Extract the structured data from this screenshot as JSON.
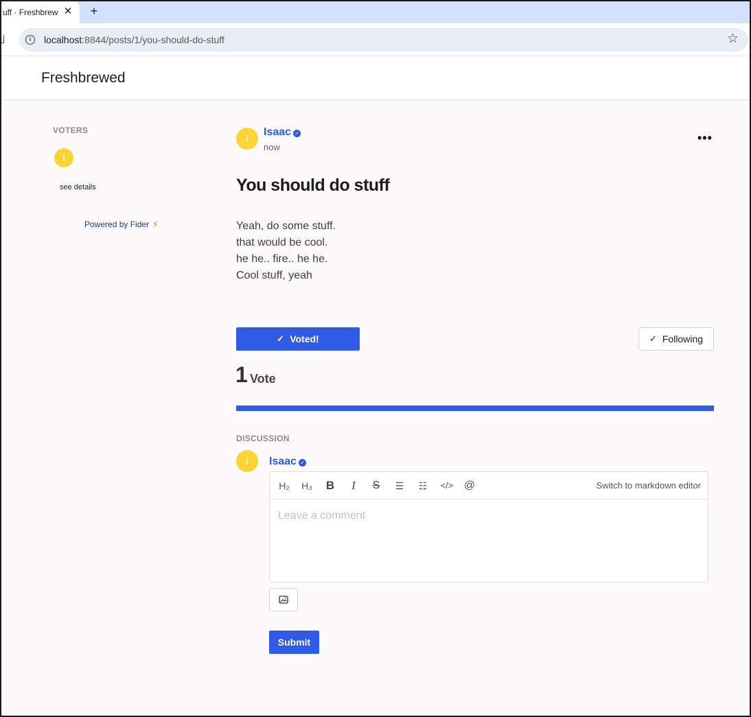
{
  "browser": {
    "tab_title": "uff · Freshbrew",
    "close_glyph": "✕",
    "new_tab_glyph": "+",
    "url_host": "localhost",
    "url_rest": ":8844/posts/1/you-should-do-stuff",
    "star_glyph": "☆",
    "icons": [
      "info-icon",
      "star-icon",
      "close-icon",
      "plus-icon"
    ]
  },
  "header": {
    "brand": "Freshbrewed"
  },
  "sidebar": {
    "voters_title": "VOTERS",
    "voters": [
      {
        "initial": "I"
      }
    ],
    "see_details": "see details",
    "powered_by": "Powered by Fider",
    "bolt_glyph": "⚡"
  },
  "post": {
    "author": {
      "name": "Isaac",
      "initial": "I",
      "verified_glyph": "✓"
    },
    "time": "now",
    "more_glyph": "•••",
    "title": "You should do stuff",
    "body_lines": [
      "Yeah, do some stuff.",
      "that would be cool.",
      "he he.. fire.. he he.",
      "Cool stuff, yeah"
    ],
    "voted_label": "Voted!",
    "following_label": "Following",
    "check_glyph": "✓",
    "vote_count": "1",
    "vote_label": "Vote",
    "accent_color": "#2f5be7"
  },
  "discussion": {
    "title": "DISCUSSION",
    "author": {
      "name": "Isaac",
      "initial": "I",
      "verified_glyph": "✓"
    },
    "toolbar": {
      "h2": "H₂",
      "h3": "H₃",
      "bold": "B",
      "italic": "I",
      "strike": "S",
      "bullet_list": "☰",
      "ordered_list": "☷",
      "code": "</>",
      "mention": "@",
      "switch_label": "Switch to markdown editor"
    },
    "comment_placeholder": "Leave a comment",
    "submit_label": "Submit"
  }
}
